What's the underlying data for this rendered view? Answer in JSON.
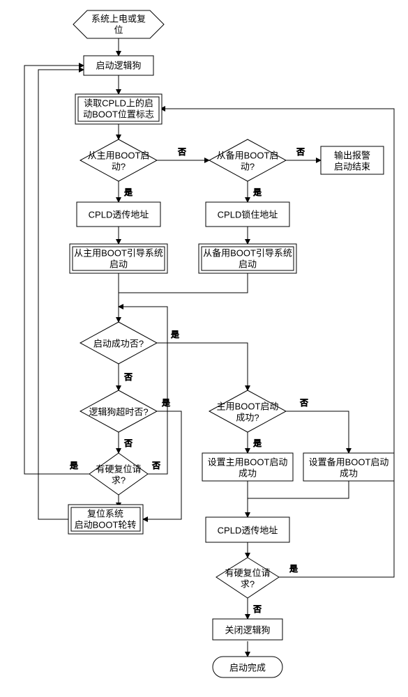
{
  "nodes": {
    "start": {
      "l1": "系统上电或复",
      "l2": "位"
    },
    "startLogicDog": {
      "l1": "启动逻辑狗"
    },
    "readFlag": {
      "l1": "读取CPLD上的启",
      "l2": "动BOOT位置标志"
    },
    "fromMain": {
      "l1": "从主用BOOT启",
      "l2": "动?"
    },
    "fromBackup": {
      "l1": "从备用BOOT启",
      "l2": "动?"
    },
    "alarm": {
      "l1": "输出报警",
      "l2": "启动结束"
    },
    "cpldPass": {
      "l1": "CPLD透传地址"
    },
    "cpldLock": {
      "l1": "CPLD锁住地址"
    },
    "bootMain": {
      "l1": "从主用BOOT引导系统",
      "l2": "启动"
    },
    "bootBackup": {
      "l1": "从备用BOOT引导系统",
      "l2": "启动"
    },
    "bootOk": {
      "l1": "启动成功否?"
    },
    "dogTimeout": {
      "l1": "逻辑狗超时否?"
    },
    "hardReset1": {
      "l1": "有硬复位请",
      "l2": "求?"
    },
    "mainBootOk": {
      "l1": "主用BOOT启动",
      "l2": "成功?"
    },
    "setMainOk": {
      "l1": "设置主用BOOT启动",
      "l2": "成功"
    },
    "setBackupOk": {
      "l1": "设置备用BOOT启动",
      "l2": "成功"
    },
    "cpldPass2": {
      "l1": "CPLD透传地址"
    },
    "hardReset2": {
      "l1": "有硬复位请",
      "l2": "求?"
    },
    "resetRotate": {
      "l1": "复位系统",
      "l2": "启动BOOT轮转"
    },
    "closeDog": {
      "l1": "关闭逻辑狗"
    },
    "done": {
      "l1": "启动完成"
    }
  },
  "labels": {
    "yes": "是",
    "no": "否"
  },
  "chart_data": {
    "type": "flowchart",
    "nodes": [
      {
        "id": "start",
        "kind": "start",
        "text": "系统上电或复位"
      },
      {
        "id": "startLogicDog",
        "kind": "process",
        "text": "启动逻辑狗"
      },
      {
        "id": "readFlag",
        "kind": "process",
        "text": "读取CPLD上的启动BOOT位置标志"
      },
      {
        "id": "fromMain",
        "kind": "decision",
        "text": "从主用BOOT启动?"
      },
      {
        "id": "fromBackup",
        "kind": "decision",
        "text": "从备用BOOT启动?"
      },
      {
        "id": "alarm",
        "kind": "process",
        "text": "输出报警 启动结束"
      },
      {
        "id": "cpldPass",
        "kind": "process",
        "text": "CPLD透传地址"
      },
      {
        "id": "cpldLock",
        "kind": "process",
        "text": "CPLD锁住地址"
      },
      {
        "id": "bootMain",
        "kind": "process",
        "text": "从主用BOOT引导系统启动"
      },
      {
        "id": "bootBackup",
        "kind": "process",
        "text": "从备用BOOT引导系统启动"
      },
      {
        "id": "bootOk",
        "kind": "decision",
        "text": "启动成功否?"
      },
      {
        "id": "dogTimeout",
        "kind": "decision",
        "text": "逻辑狗超时否?"
      },
      {
        "id": "hardReset1",
        "kind": "decision",
        "text": "有硬复位请求?"
      },
      {
        "id": "mainBootOk",
        "kind": "decision",
        "text": "主用BOOT启动成功?"
      },
      {
        "id": "setMainOk",
        "kind": "process",
        "text": "设置主用BOOT启动成功"
      },
      {
        "id": "setBackupOk",
        "kind": "process",
        "text": "设置备用BOOT启动成功"
      },
      {
        "id": "cpldPass2",
        "kind": "process",
        "text": "CPLD透传地址"
      },
      {
        "id": "hardReset2",
        "kind": "decision",
        "text": "有硬复位请求?"
      },
      {
        "id": "resetRotate",
        "kind": "process",
        "text": "复位系统 启动BOOT轮转"
      },
      {
        "id": "closeDog",
        "kind": "process",
        "text": "关闭逻辑狗"
      },
      {
        "id": "done",
        "kind": "end",
        "text": "启动完成"
      }
    ],
    "edges": [
      {
        "from": "start",
        "to": "startLogicDog"
      },
      {
        "from": "startLogicDog",
        "to": "readFlag"
      },
      {
        "from": "readFlag",
        "to": "fromMain"
      },
      {
        "from": "fromMain",
        "to": "cpldPass",
        "label": "是"
      },
      {
        "from": "fromMain",
        "to": "fromBackup",
        "label": "否"
      },
      {
        "from": "fromBackup",
        "to": "cpldLock",
        "label": "是"
      },
      {
        "from": "fromBackup",
        "to": "alarm",
        "label": "否"
      },
      {
        "from": "cpldPass",
        "to": "bootMain"
      },
      {
        "from": "cpldLock",
        "to": "bootBackup"
      },
      {
        "from": "bootMain",
        "to": "bootOk"
      },
      {
        "from": "bootBackup",
        "to": "bootOk"
      },
      {
        "from": "bootOk",
        "to": "mainBootOk",
        "label": "是"
      },
      {
        "from": "bootOk",
        "to": "dogTimeout",
        "label": "否"
      },
      {
        "from": "dogTimeout",
        "to": "resetRotate",
        "label": "是"
      },
      {
        "from": "dogTimeout",
        "to": "hardReset1",
        "label": "否"
      },
      {
        "from": "hardReset1",
        "to": "startLogicDog",
        "label": "是"
      },
      {
        "from": "hardReset1",
        "to": "bootOk",
        "label": "否"
      },
      {
        "from": "mainBootOk",
        "to": "setMainOk",
        "label": "是"
      },
      {
        "from": "mainBootOk",
        "to": "setBackupOk",
        "label": "否"
      },
      {
        "from": "setMainOk",
        "to": "cpldPass2"
      },
      {
        "from": "setBackupOk",
        "to": "cpldPass2"
      },
      {
        "from": "cpldPass2",
        "to": "hardReset2"
      },
      {
        "from": "hardReset2",
        "to": "closeDog",
        "label": "否"
      },
      {
        "from": "hardReset2",
        "to": "readFlag",
        "label": "是"
      },
      {
        "from": "closeDog",
        "to": "done"
      },
      {
        "from": "resetRotate",
        "to": "startLogicDog"
      }
    ]
  }
}
